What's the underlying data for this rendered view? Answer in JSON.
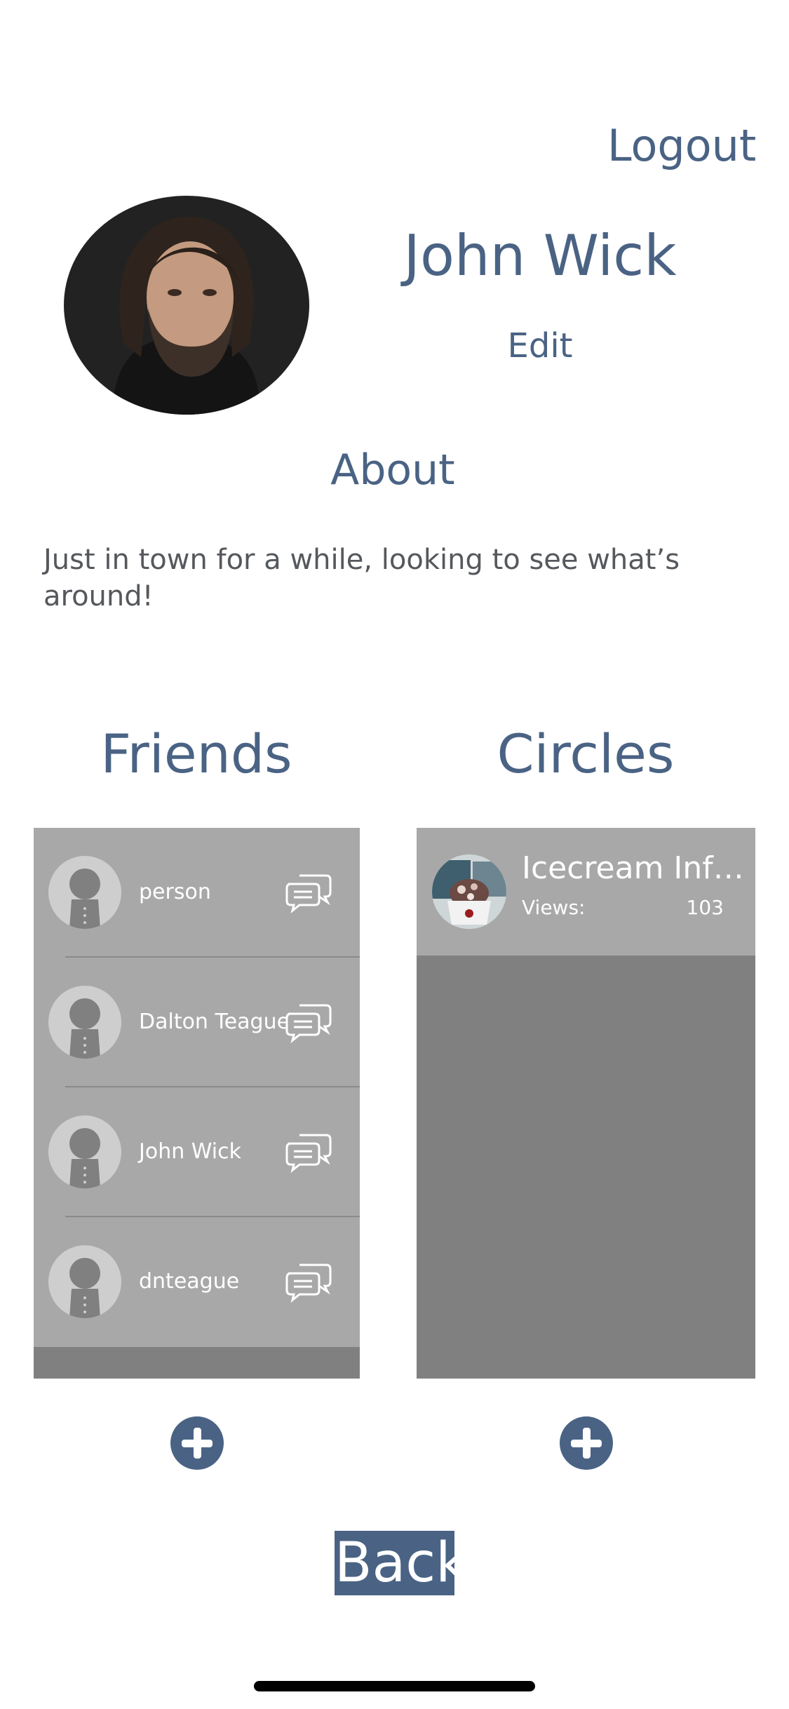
{
  "header": {
    "logout_label": "Logout"
  },
  "profile": {
    "name": "John Wick",
    "edit_label": "Edit"
  },
  "about": {
    "heading": "About",
    "bio": "Just in town for a while, looking to see what’s around!"
  },
  "friends": {
    "title": "Friends",
    "items": [
      {
        "name": "person"
      },
      {
        "name": "Dalton Teague"
      },
      {
        "name": "John Wick"
      },
      {
        "name": "dnteague"
      }
    ]
  },
  "circles": {
    "title": "Circles",
    "items": [
      {
        "name": "Icecream Info...",
        "views_label": "Views:",
        "views": "103"
      }
    ]
  },
  "footer": {
    "back_label": "Back"
  },
  "colors": {
    "accent": "#4a6384",
    "panel_bg": "#808080",
    "row_bg": "#a8a8a8"
  },
  "icons": [
    "avatar-placeholder-icon",
    "chat-bubbles-icon",
    "plus-circle-icon"
  ]
}
